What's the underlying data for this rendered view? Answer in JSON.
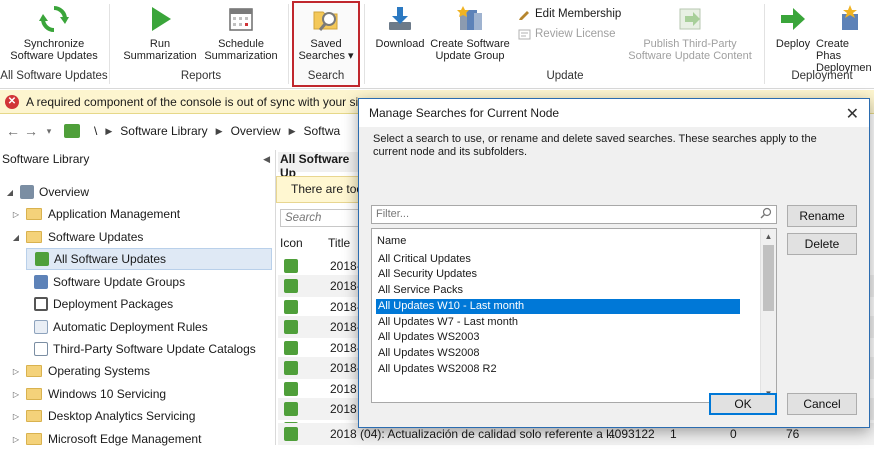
{
  "ribbon": {
    "sync_label_1": "Synchronize",
    "sync_label_2": "Software Updates",
    "run_label_1": "Run",
    "run_label_2": "Summarization",
    "schedule_label_1": "Schedule",
    "schedule_label_2": "Summarization",
    "saved_label_1": "Saved",
    "saved_label_2": "Searches ▾",
    "download_label": "Download",
    "create_group_label_1": "Create Software",
    "create_group_label_2": "Update Group",
    "edit_membership_label": "Edit Membership",
    "review_license_label": "Review License",
    "publish_label_1": "Publish Third-Party",
    "publish_label_2": "Software Update Content",
    "deploy_label": "Deploy",
    "create_phased_label_1": "Create Phas",
    "create_phased_label_2": "Deploymen",
    "groups": {
      "all_updates": "All Software Updates",
      "reports": "Reports",
      "search": "Search",
      "update": "Update",
      "deployment": "Deployment"
    }
  },
  "warning": {
    "text": "A required component of the console is out of sync with your site."
  },
  "breadcrumb": {
    "root_sep": "\\",
    "items": [
      "Software Library",
      "Overview",
      "Softwa"
    ]
  },
  "nav": {
    "title": "Software Library",
    "items": [
      {
        "label": "Overview"
      },
      {
        "label": "Application Management"
      },
      {
        "label": "Software Updates"
      },
      {
        "label": "All Software Updates"
      },
      {
        "label": "Software Update Groups"
      },
      {
        "label": "Deployment Packages"
      },
      {
        "label": "Automatic Deployment Rules"
      },
      {
        "label": "Third-Party Software Update Catalogs"
      },
      {
        "label": "Operating Systems"
      },
      {
        "label": "Windows 10 Servicing"
      },
      {
        "label": "Desktop Analytics Servicing"
      },
      {
        "label": "Microsoft Edge Management"
      }
    ]
  },
  "results": {
    "title": "All Software Up",
    "banner": "There are too",
    "search_placeholder": "Search",
    "col_icon": "Icon",
    "col_title": "Title",
    "rows": [
      {
        "title": "2018-"
      },
      {
        "title": "2018-"
      },
      {
        "title": "2018-"
      },
      {
        "title": "2018-"
      },
      {
        "title": "2018-"
      },
      {
        "title": "2018-"
      },
      {
        "title": "2018"
      },
      {
        "title": "2018"
      },
      {
        "title": "2018"
      },
      {
        "title": "2018 (04): Actualización de calidad solo referente a l...",
        "col2": "4093122",
        "col3": "1",
        "col4": "0",
        "col5": "76"
      }
    ]
  },
  "dialog": {
    "title": "Manage Searches for Current Node",
    "close": "✕",
    "description": "Select a search to use, or rename and delete saved searches. These searches apply to the current node and its subfolders.",
    "filter_placeholder": "Filter...",
    "list_header": "Name",
    "items": [
      "All Critical Updates",
      "All Security Updates",
      "All Service Packs",
      "All Updates W10 - Last month",
      "All Updates W7 - Last month",
      "All Updates WS2003",
      "All Updates WS2008",
      "All Updates WS2008 R2"
    ],
    "selected_index": 3,
    "rename_label": "Rename",
    "delete_label": "Delete",
    "ok_label": "OK",
    "cancel_label": "Cancel"
  }
}
